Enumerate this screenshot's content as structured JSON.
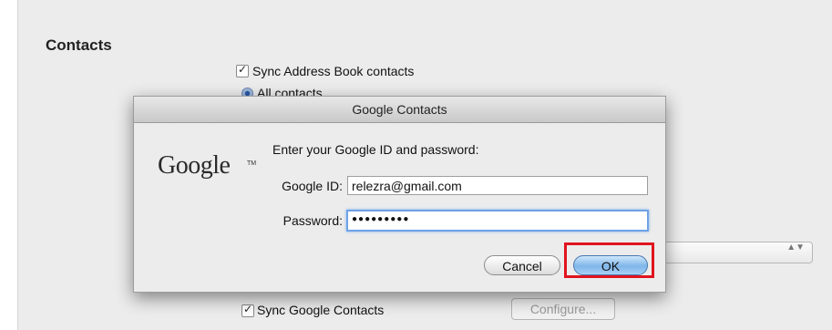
{
  "background": {
    "section_title": "Contacts",
    "sync_address_book_label": "Sync Address Book contacts",
    "all_contacts_label": "All contacts",
    "sync_google_label": "Sync Google Contacts",
    "configure_label": "Configure...",
    "select_arrows": "▲▼"
  },
  "dialog": {
    "title": "Google Contacts",
    "logo_text": "Google",
    "logo_tm": "TM",
    "prompt": "Enter your Google ID and password:",
    "google_id_label": "Google ID:",
    "google_id_value": "relezra@gmail.com",
    "password_label": "Password:",
    "password_value": "●●●●●●●●●",
    "cancel_label": "Cancel",
    "ok_label": "OK"
  },
  "colors": {
    "highlight": "#e0141e",
    "ok_button": "#7fb6ea",
    "focus_ring": "#6ea2e6"
  }
}
